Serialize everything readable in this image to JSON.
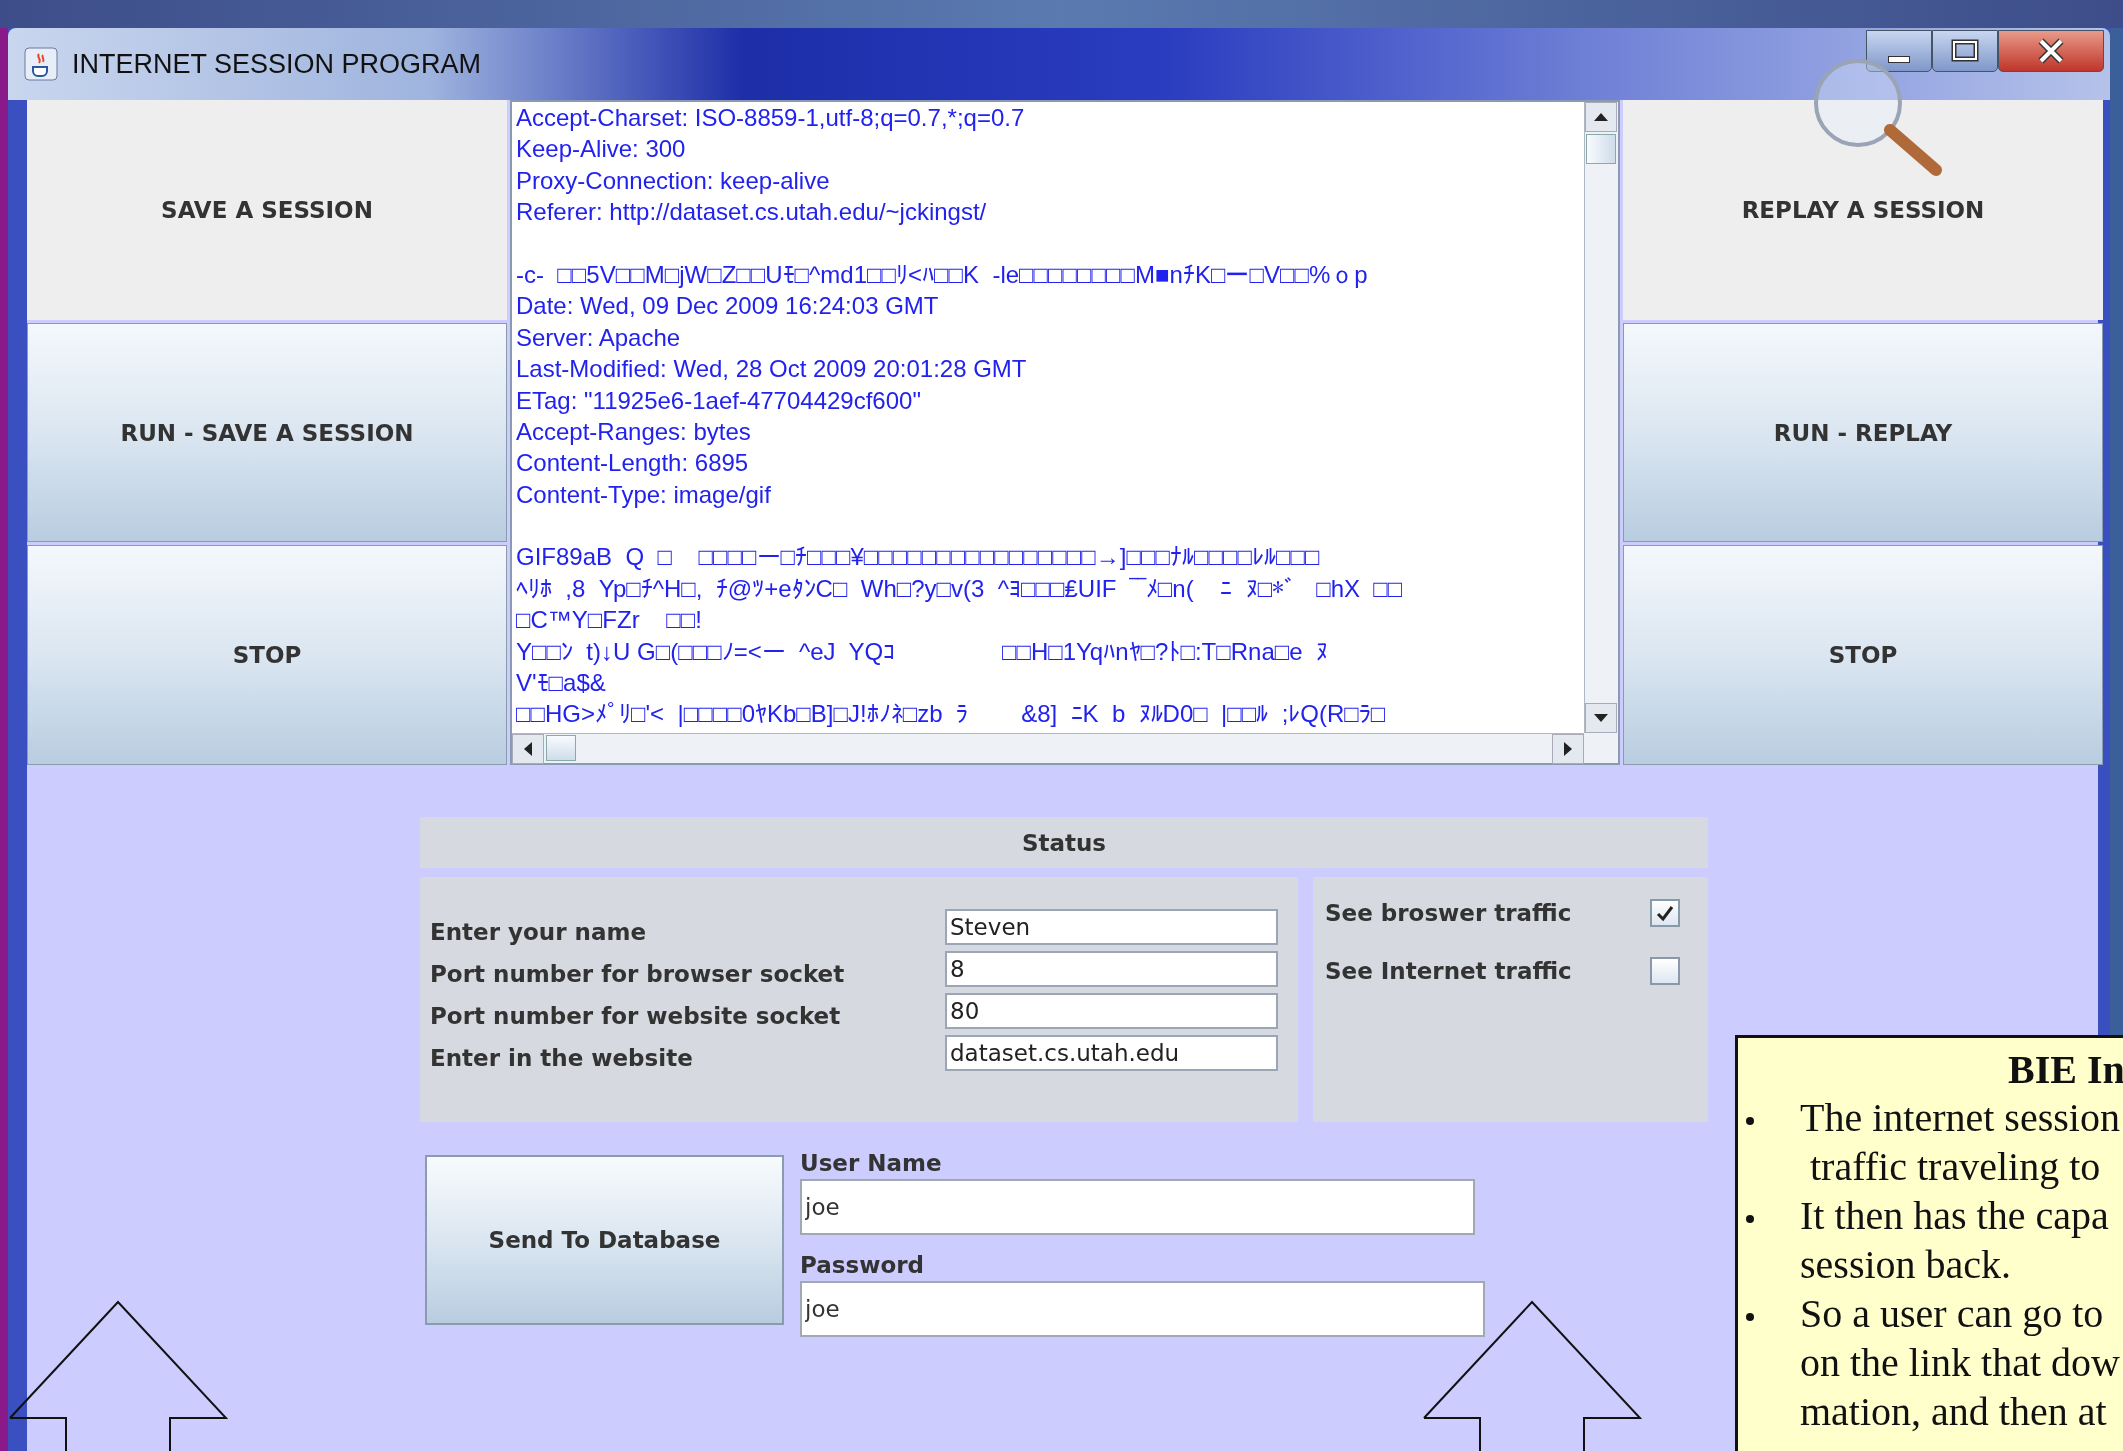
{
  "window": {
    "title": "INTERNET SESSION PROGRAM"
  },
  "left_buttons": [
    "SAVE A SESSION",
    "RUN - SAVE A SESSION",
    "STOP"
  ],
  "right_buttons": [
    "REPLAY A SESSION",
    "RUN - REPLAY",
    "STOP"
  ],
  "traffic_log": {
    "blocks": [
      [
        "Accept-Charset: ISO-8859-1,utf-8;q=0.7,*;q=0.7",
        "Keep-Alive: 300",
        "Proxy-Connection: keep-alive",
        "Referer: http://dataset.cs.utah.edu/~jckingst/"
      ],
      [
        "-c-  □□5V□□M□jW□Z□□Uﾓ□^md1□□ﾘ<ﾊ□□K  -le□□□□□□□□M■nﾁK□ー□V□□%ｏp",
        "Date: Wed, 09 Dec 2009 16:24:03 GMT",
        "Server: Apache",
        "Last-Modified: Wed, 28 Oct 2009 20:01:28 GMT",
        "ETag: \"11925e6-1aef-47704429cf600\"",
        "Accept-Ranges: bytes",
        "Content-Length: 6895",
        "Content-Type: image/gif"
      ],
      [
        "GIF89aB  Q  □    □□□□ー□ﾁ□□□¥□□□□□□□□□□□□□□□□→]□□□ﾅﾙ□□□□ﾚﾙ□□□",
        "ﾍﾘﾎ  ,8  Yp□ﾁ^H□,  ﾁ@ﾂ+eﾀﾝC□  Wh□?y□v(3  ^ﾖ□□□₤UIF  ‾‾ﾒ□n(    ﾆ  ﾇ□*ﾞ   □hX  □□",
        "□C™Y□FZr    □□!",
        "Y□□ﾝ  t)↓U G□(□□□ﾉ=<ー  ^eJ  YQｺ                □□H□1Yqﾊnﾔ□?ﾄ□:T□Rna□e  ﾇ",
        "V'ﾓ□a$&",
        "□□HG>ﾒﾟﾘ□'<  |□□□□0ﾔKb□B]□J!ﾎﾉﾈ□zb  ﾗ        &8]  ﾆK  b  ﾇﾙD0□  |□□ﾙ  ;ﾚQ(R□ﾗ□"
      ]
    ]
  },
  "status": {
    "title": "Status",
    "fields": [
      {
        "label": "Enter your name",
        "value": "Steven"
      },
      {
        "label": "Port number for browser socket",
        "value": "8"
      },
      {
        "label": "Port number for website socket",
        "value": "80"
      },
      {
        "label": "Enter in the website",
        "value": "dataset.cs.utah.edu"
      }
    ],
    "options": [
      {
        "label": "See broswer traffic",
        "checked": true
      },
      {
        "label": "See Internet traffic",
        "checked": false
      }
    ]
  },
  "database": {
    "button": "Send To Database",
    "fields": [
      {
        "label": "User Name",
        "value": "joe"
      },
      {
        "label": "Password",
        "value": "joe"
      }
    ]
  },
  "slide_note": {
    "title": "BIE In",
    "bullets": [
      {
        "lines": [
          "The internet session",
          " traffic traveling to"
        ]
      },
      {
        "lines": [
          "It then has the capa",
          "session back."
        ]
      },
      {
        "lines": [
          "So a user can go to",
          "on the link that dow",
          "mation, and then at"
        ]
      }
    ]
  }
}
